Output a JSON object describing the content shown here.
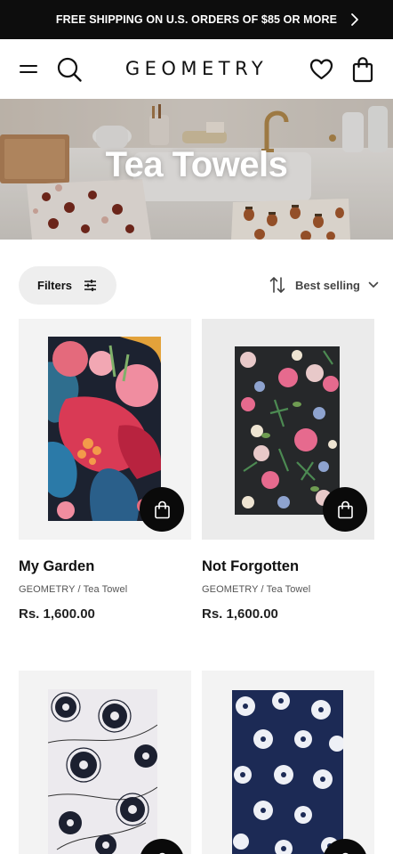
{
  "announcement": {
    "text": "FREE SHIPPING ON U.S. ORDERS OF $85 OR MORE",
    "arrow_icon": "chevron-right-icon"
  },
  "header": {
    "logo": "GEOMETRY",
    "icons": [
      "menu-icon",
      "search-icon",
      "heart-icon",
      "shopping-bag-icon"
    ]
  },
  "hero": {
    "title": "Tea Towels"
  },
  "toolbar": {
    "filters_label": "Filters",
    "sort_label": "Best selling"
  },
  "products": [
    {
      "title": "My Garden",
      "brand": "GEOMETRY",
      "type": "Tea Towel",
      "meta": "GEOMETRY / Tea Towel",
      "price": "Rs. 1,600.00"
    },
    {
      "title": "Not Forgotten",
      "brand": "GEOMETRY",
      "type": "Tea Towel",
      "meta": "GEOMETRY / Tea Towel",
      "price": "Rs. 1,600.00"
    },
    {
      "title": "",
      "brand": "",
      "type": "",
      "meta": "",
      "price": ""
    },
    {
      "title": "",
      "brand": "",
      "type": "",
      "meta": "",
      "price": ""
    }
  ],
  "colors": {
    "announcement_bg": "#0d0d0d",
    "filters_bg": "#eeeeee",
    "card_bg": "#f3f3f3",
    "cart_button_bg": "#0a0a0a"
  }
}
